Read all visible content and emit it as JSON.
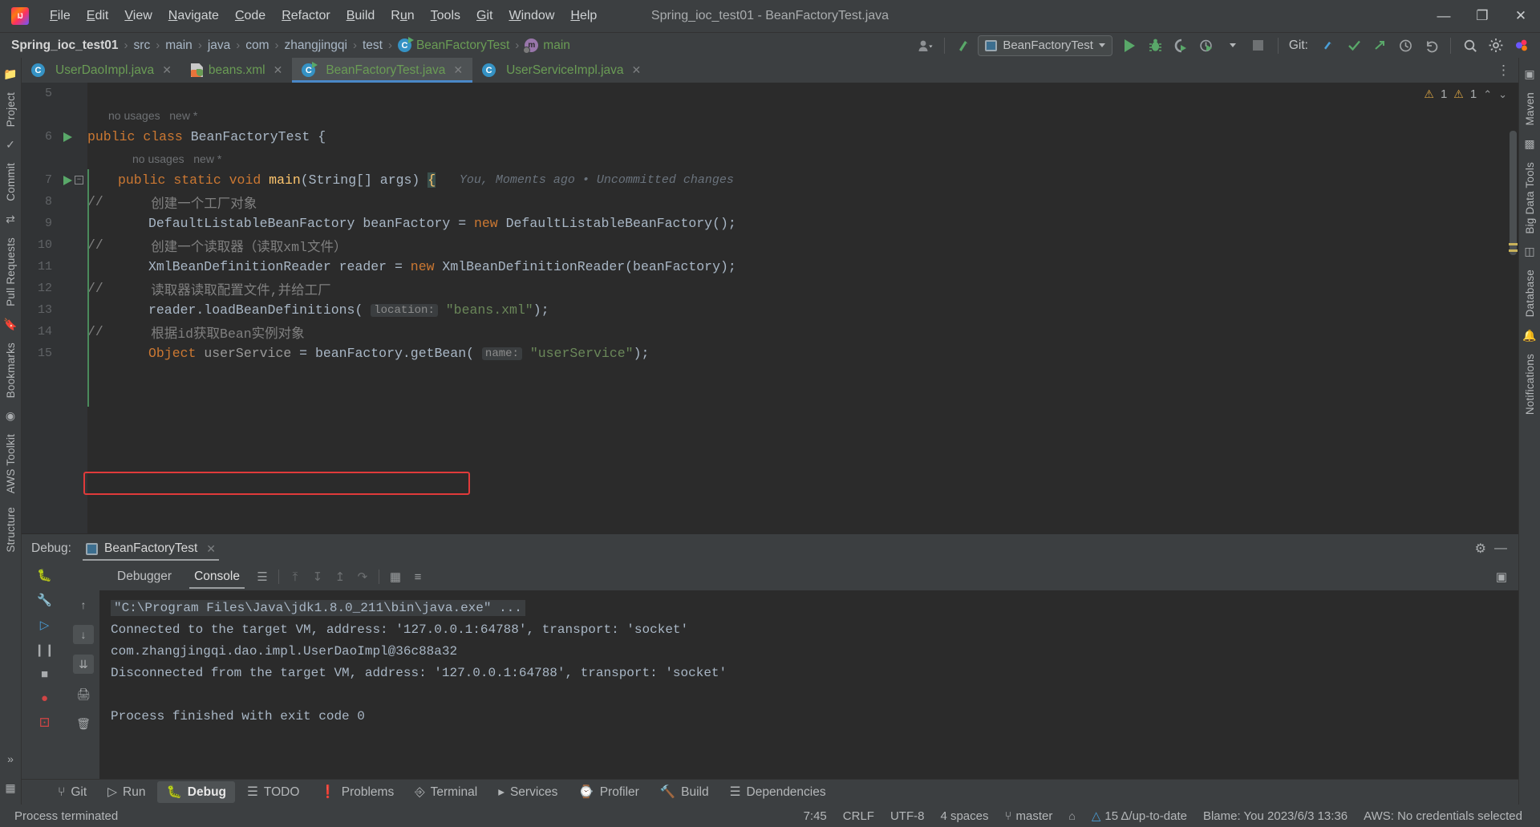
{
  "window": {
    "title": "Spring_ioc_test01 - BeanFactoryTest.java",
    "minimize": "—",
    "maximize": "❐",
    "close": "✕"
  },
  "menu": {
    "items": [
      "File",
      "Edit",
      "View",
      "Navigate",
      "Code",
      "Refactor",
      "Build",
      "Run",
      "Tools",
      "Git",
      "Window",
      "Help"
    ]
  },
  "navbar": {
    "breadcrumbs": [
      {
        "label": "Spring_ioc_test01",
        "kind": "project"
      },
      {
        "label": "src",
        "kind": "dir"
      },
      {
        "label": "main",
        "kind": "dir"
      },
      {
        "label": "java",
        "kind": "dir"
      },
      {
        "label": "com",
        "kind": "dir"
      },
      {
        "label": "zhangjingqi",
        "kind": "dir"
      },
      {
        "label": "test",
        "kind": "dir"
      },
      {
        "label": "BeanFactoryTest",
        "kind": "class"
      },
      {
        "label": "main",
        "kind": "method"
      }
    ],
    "separator": "›",
    "class_icon_letter": "C",
    "method_icon_letter": "m",
    "run_config": "BeanFactoryTest",
    "git_label": "Git:",
    "toolbar_icons": [
      "user-avatar-icon",
      "update-project-icon",
      "run-icon",
      "debug-icon",
      "run-with-coverage-icon",
      "profiler-icon",
      "stop-icon",
      "git-commit-icon",
      "git-update-icon",
      "git-push-icon",
      "history-icon",
      "undo-icon",
      "search-everywhere-icon",
      "settings-icon",
      "plugin-icon"
    ]
  },
  "left_rail": {
    "items": [
      "Project",
      "Commit",
      "Pull Requests",
      "Bookmarks",
      "AWS Toolkit",
      "Structure"
    ],
    "more": "»"
  },
  "right_rail": {
    "items": [
      "Maven",
      "Big Data Tools",
      "Database",
      "Notifications"
    ]
  },
  "editor_tabs": {
    "tabs": [
      {
        "label": "UserDaoImpl.java",
        "icon": "java-class-icon",
        "active": false
      },
      {
        "label": "beans.xml",
        "icon": "spring-xml-icon",
        "active": false
      },
      {
        "label": "BeanFactoryTest.java",
        "icon": "java-runnable-class-icon",
        "active": true
      },
      {
        "label": "UserServiceImpl.java",
        "icon": "java-class-icon",
        "active": false
      }
    ],
    "close_glyph": "✕",
    "more_glyph": "⋮"
  },
  "inspection": {
    "warnings_a": "1",
    "warnings_b": "1",
    "warn_glyph": "⚠",
    "up_glyph": "⌃",
    "down_glyph": "⌄"
  },
  "editor": {
    "lines": [
      {
        "num": "5",
        "gutter": "",
        "segments": []
      },
      {
        "num": "",
        "gutter": "",
        "usage": "no usages   new *"
      },
      {
        "num": "6",
        "gutter": "run",
        "code_html": "public_class_BeanFactoryTest"
      },
      {
        "num": "",
        "gutter": "",
        "usage": "no usages   new *"
      },
      {
        "num": "7",
        "gutter": "run-fold",
        "code_html": "main_method"
      },
      {
        "num": "8",
        "gutter": "",
        "code_html": "comment_factory"
      },
      {
        "num": "9",
        "gutter": "",
        "code_html": "bean_factory_decl"
      },
      {
        "num": "10",
        "gutter": "",
        "code_html": "comment_reader"
      },
      {
        "num": "11",
        "gutter": "",
        "code_html": "reader_decl"
      },
      {
        "num": "12",
        "gutter": "",
        "code_html": "comment_load"
      },
      {
        "num": "13",
        "gutter": "",
        "code_html": "load_call"
      },
      {
        "num": "14",
        "gutter": "",
        "code_html": "comment_getbean"
      },
      {
        "num": "15",
        "gutter": "",
        "code_html": "getbean_call"
      }
    ],
    "text": {
      "l6": {
        "kw1": "public",
        "kw2": "class",
        "name": "BeanFactoryTest",
        "brace": "{"
      },
      "l7": {
        "kw1": "public",
        "kw2": "static",
        "kw3": "void",
        "name": "main",
        "params": "(String[] args)",
        "brace": "{",
        "annotation": "You, Moments ago • Uncommitted changes"
      },
      "l8": {
        "slashes": "//",
        "text": "创建一个工厂对象"
      },
      "l9": {
        "type": "DefaultListableBeanFactory",
        "var": "beanFactory",
        "eq": "=",
        "kw": "new",
        "ctor": "DefaultListableBeanFactory();"
      },
      "l10": {
        "slashes": "//",
        "text": "创建一个读取器（读取xml文件）"
      },
      "l11": {
        "type": "XmlBeanDefinitionReader",
        "var": "reader",
        "eq": "=",
        "kw": "new",
        "ctor": "XmlBeanDefinitionReader(beanFactory);"
      },
      "l12": {
        "slashes": "//",
        "text": "读取器读取配置文件,并给工厂"
      },
      "l13": {
        "call": "reader.loadBeanDefinitions(",
        "hint": "location:",
        "str": "\"beans.xml\"",
        "end": ");"
      },
      "l14": {
        "slashes": "//",
        "text": "根据id获取Bean实例对象"
      },
      "l15": {
        "type": "Object",
        "var": "userService",
        "eq": "=",
        "call": "beanFactory.getBean(",
        "hint": "name:",
        "str": "\"userService\"",
        "end": ");"
      }
    },
    "usage_hint": "no usages   new *"
  },
  "debug_panel": {
    "title": "Debug:",
    "session_tab": "BeanFactoryTest",
    "close_glyph": "✕",
    "tabs": [
      {
        "label": "Debugger",
        "selected": false
      },
      {
        "label": "Console",
        "selected": true
      }
    ],
    "toolbar_icons": [
      "frames-icon",
      "step-over-icon",
      "step-into-icon",
      "step-out-icon",
      "run-to-cursor-icon",
      "evaluate-icon",
      "soft-wrap-icon"
    ],
    "left_icons": [
      "bug-icon",
      "rerun-icon",
      "resume-icon",
      "pause-icon",
      "stop-icon",
      "breakpoints-icon",
      "mute-breakpoints-icon"
    ],
    "mid_icons": [
      "wrench-icon",
      "up-arrow-icon",
      "down-arrow-icon",
      "settings-gear-icon",
      "print-icon",
      "trash-icon"
    ],
    "settings_glyph": "⚙",
    "minimize_glyph": "—"
  },
  "console": {
    "lines": [
      {
        "text": "\"C:\\Program Files\\Java\\jdk1.8.0_211\\bin\\java.exe\" ...",
        "boxed": true,
        "highlighted": false
      },
      {
        "text": "Connected to the target VM, address: '127.0.0.1:64788', transport: 'socket'",
        "boxed": false,
        "highlighted": false
      },
      {
        "text": "com.zhangjingqi.dao.impl.UserDaoImpl@36c88a32",
        "boxed": false,
        "highlighted": true
      },
      {
        "text": "Disconnected from the target VM, address: '127.0.0.1:64788', transport: 'socket'",
        "boxed": false,
        "highlighted": false
      },
      {
        "text": "",
        "boxed": false,
        "highlighted": false
      },
      {
        "text": "Process finished with exit code 0",
        "boxed": false,
        "highlighted": false
      }
    ],
    "highlight_color": "#e03a3a"
  },
  "bottom_bar": {
    "items": [
      {
        "label": "Git",
        "icon": "git-branch-icon",
        "selected": false
      },
      {
        "label": "Run",
        "icon": "run-icon",
        "selected": false
      },
      {
        "label": "Debug",
        "icon": "bug-icon",
        "selected": true
      },
      {
        "label": "TODO",
        "icon": "todo-icon",
        "selected": false
      },
      {
        "label": "Problems",
        "icon": "problems-icon",
        "selected": false
      },
      {
        "label": "Terminal",
        "icon": "terminal-icon",
        "selected": false
      },
      {
        "label": "Services",
        "icon": "services-icon",
        "selected": false
      },
      {
        "label": "Profiler",
        "icon": "profiler-icon",
        "selected": false
      },
      {
        "label": "Build",
        "icon": "build-hammer-icon",
        "selected": false
      },
      {
        "label": "Dependencies",
        "icon": "dependencies-icon",
        "selected": false
      }
    ]
  },
  "status_bar": {
    "message": "Process terminated",
    "caret": "7:45",
    "line_sep": "CRLF",
    "encoding": "UTF-8",
    "indent": "4 spaces",
    "branch": "master",
    "lock_glyph": "⌂",
    "vcs_status": "15 Δ/up-to-date",
    "blame": "Blame: You 2023/6/3 13:36",
    "aws": "AWS: No credentials selected",
    "branch_icon": "git-branch-icon",
    "vcs_icon": "warning-triangle-icon"
  }
}
